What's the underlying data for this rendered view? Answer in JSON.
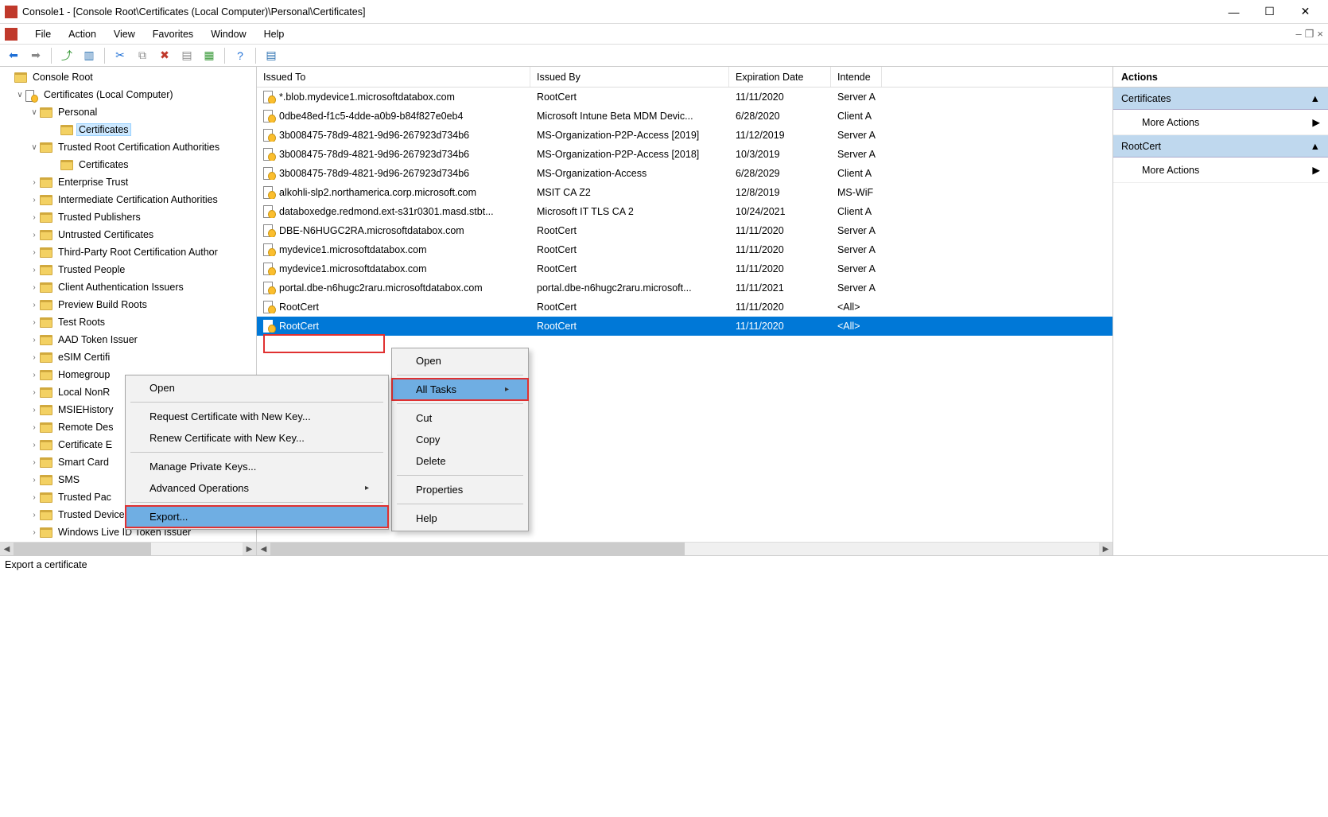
{
  "window": {
    "title": "Console1 - [Console Root\\Certificates (Local Computer)\\Personal\\Certificates]"
  },
  "menu": {
    "file": "File",
    "action": "Action",
    "view": "View",
    "favorites": "Favorites",
    "window": "Window",
    "help": "Help"
  },
  "tree": {
    "root": "Console Root",
    "certs_local": "Certificates (Local Computer)",
    "personal": "Personal",
    "certificates": "Certificates",
    "trca": "Trusted Root Certification Authorities",
    "certificates2": "Certificates",
    "items": [
      "Enterprise Trust",
      "Intermediate Certification Authorities",
      "Trusted Publishers",
      "Untrusted Certificates",
      "Third-Party Root Certification Author",
      "Trusted People",
      "Client Authentication Issuers",
      "Preview Build Roots",
      "Test Roots",
      "AAD Token Issuer",
      "eSIM Certifi",
      "Homegroup",
      "Local NonR",
      "MSIEHistory",
      "Remote Des",
      "Certificate E",
      "Smart Card",
      "SMS",
      "Trusted Pac",
      "Trusted Devices",
      "Windows Live ID Token Issuer"
    ]
  },
  "columns": {
    "c0": "Issued To",
    "c1": "Issued By",
    "c2": "Expiration Date",
    "c3": "Intende"
  },
  "rows": [
    {
      "to": "*.blob.mydevice1.microsoftdatabox.com",
      "by": "RootCert",
      "exp": "11/11/2020",
      "pur": "Server A"
    },
    {
      "to": "0dbe48ed-f1c5-4dde-a0b9-b84f827e0eb4",
      "by": "Microsoft Intune Beta MDM Devic...",
      "exp": "6/28/2020",
      "pur": "Client A"
    },
    {
      "to": "3b008475-78d9-4821-9d96-267923d734b6",
      "by": "MS-Organization-P2P-Access [2019]",
      "exp": "11/12/2019",
      "pur": "Server A"
    },
    {
      "to": "3b008475-78d9-4821-9d96-267923d734b6",
      "by": "MS-Organization-P2P-Access [2018]",
      "exp": "10/3/2019",
      "pur": "Server A"
    },
    {
      "to": "3b008475-78d9-4821-9d96-267923d734b6",
      "by": "MS-Organization-Access",
      "exp": "6/28/2029",
      "pur": "Client A"
    },
    {
      "to": "alkohli-slp2.northamerica.corp.microsoft.com",
      "by": "MSIT CA Z2",
      "exp": "12/8/2019",
      "pur": "MS-WiF"
    },
    {
      "to": "databoxedge.redmond.ext-s31r0301.masd.stbt...",
      "by": "Microsoft IT TLS CA 2",
      "exp": "10/24/2021",
      "pur": "Client A"
    },
    {
      "to": "DBE-N6HUGC2RA.microsoftdatabox.com",
      "by": "RootCert",
      "exp": "11/11/2020",
      "pur": "Server A"
    },
    {
      "to": "mydevice1.microsoftdatabox.com",
      "by": "RootCert",
      "exp": "11/11/2020",
      "pur": "Server A"
    },
    {
      "to": "mydevice1.microsoftdatabox.com",
      "by": "RootCert",
      "exp": "11/11/2020",
      "pur": "Server A"
    },
    {
      "to": "portal.dbe-n6hugc2raru.microsoftdatabox.com",
      "by": "portal.dbe-n6hugc2raru.microsoft...",
      "exp": "11/11/2021",
      "pur": "Server A"
    },
    {
      "to": "RootCert",
      "by": "RootCert",
      "exp": "11/11/2020",
      "pur": "<All>"
    },
    {
      "to": "RootCert",
      "by": "RootCert",
      "exp": "11/11/2020",
      "pur": "<All>",
      "selected": true
    }
  ],
  "actions_pane": {
    "title": "Actions",
    "section1": "Certificates",
    "link1": "More Actions",
    "section2": "RootCert",
    "link2": "More Actions"
  },
  "ctx1": {
    "open": "Open",
    "alltasks": "All Tasks",
    "cut": "Cut",
    "copy": "Copy",
    "delete": "Delete",
    "props": "Properties",
    "help": "Help"
  },
  "ctx2": {
    "open": "Open",
    "reqnew": "Request Certificate with New Key...",
    "renewnew": "Renew Certificate with New Key...",
    "mpk": "Manage Private Keys...",
    "advops": "Advanced Operations",
    "export": "Export..."
  },
  "status": "Export a certificate"
}
